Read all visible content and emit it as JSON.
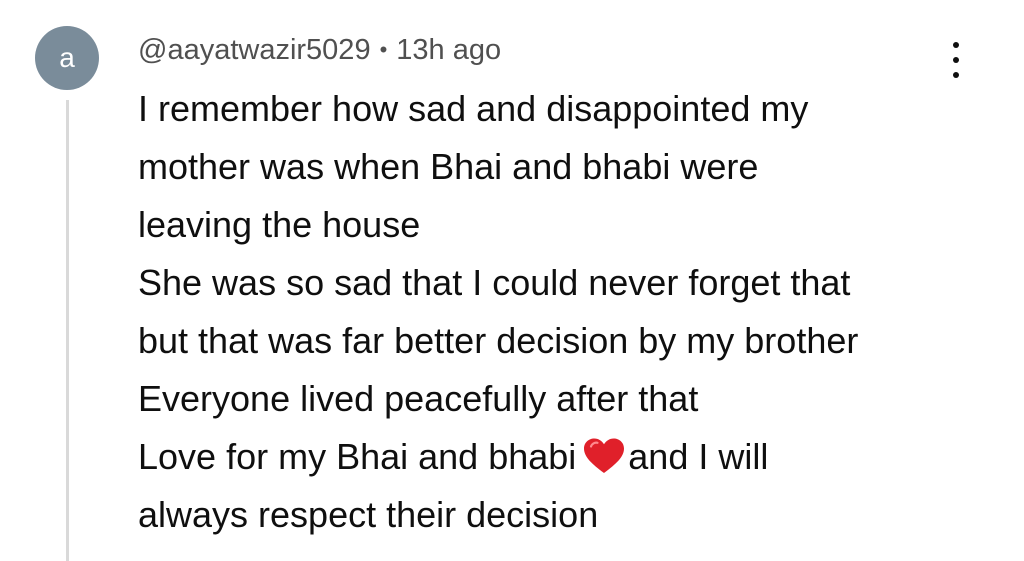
{
  "comment": {
    "avatar_letter": "a",
    "username": "@aayatwazir5029",
    "separator": "•",
    "timestamp": "13h ago",
    "more_options_icon": "vertical-ellipsis-icon",
    "lines": [
      "I remember how sad and disappointed my",
      "mother was when Bhai and bhabi were",
      "leaving the house",
      "She was so sad that I could never forget that",
      "but that was far better decision by my brother",
      "Everyone lived peacefully after that"
    ],
    "heart_line_before": "Love for my Bhai and bhabi",
    "heart_icon": "red-heart-emoji",
    "heart_line_after": "and I will",
    "last_line": "always respect their decision"
  },
  "colors": {
    "avatar_bg": "#7a8c9a",
    "text": "#0f0f0f",
    "meta_text": "#505050",
    "thread_line": "#d9d9d9",
    "heart": "#e0202a"
  }
}
